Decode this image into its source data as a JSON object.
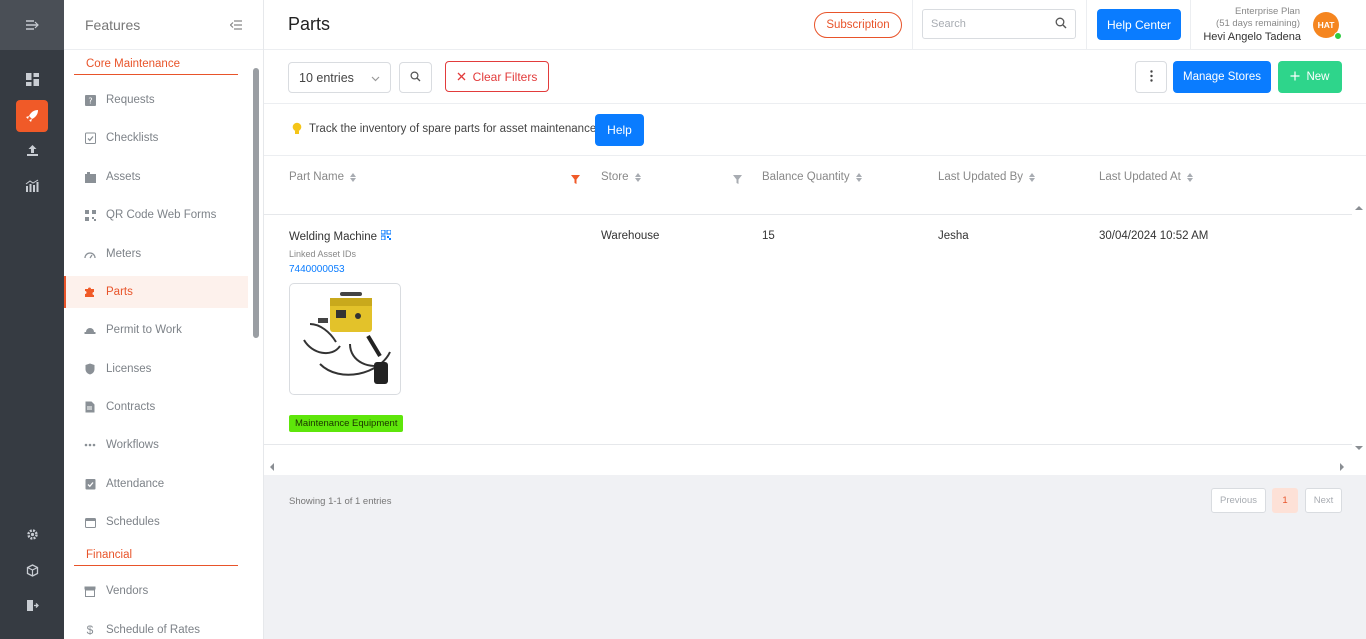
{
  "sidebar": {
    "title": "Features",
    "sections": {
      "core": "Core Maintenance",
      "financial": "Financial"
    },
    "items": [
      {
        "label": "Requests",
        "icon": "question-box-icon"
      },
      {
        "label": "Checklists",
        "icon": "checklist-icon"
      },
      {
        "label": "Assets",
        "icon": "assets-icon"
      },
      {
        "label": "QR Code Web Forms",
        "icon": "qr-code-icon"
      },
      {
        "label": "Meters",
        "icon": "meter-icon"
      },
      {
        "label": "Parts",
        "icon": "puzzle-icon"
      },
      {
        "label": "Permit to Work",
        "icon": "hard-hat-icon"
      },
      {
        "label": "Licenses",
        "icon": "shield-icon"
      },
      {
        "label": "Contracts",
        "icon": "contract-icon"
      },
      {
        "label": "Workflows",
        "icon": "dots-icon"
      },
      {
        "label": "Attendance",
        "icon": "attendance-icon"
      },
      {
        "label": "Schedules",
        "icon": "calendar-icon"
      },
      {
        "label": "Vendors",
        "icon": "vendor-icon"
      },
      {
        "label": "Schedule of Rates",
        "icon": "dollar-icon"
      }
    ]
  },
  "header": {
    "title": "Parts",
    "subscription": "Subscription",
    "search_placeholder": "Search",
    "help_center": "Help Center",
    "plan_name": "Enterprise Plan",
    "plan_remaining": "(51 days remaining)",
    "user_name": "Hevi Angelo Tadena",
    "avatar_initials": "HAT"
  },
  "toolbar": {
    "entries": "10 entries",
    "clear_filters": "Clear Filters",
    "manage_stores": "Manage Stores",
    "new": "New"
  },
  "hint": {
    "text": "Track the inventory of spare parts for asset maintenance",
    "help": "Help"
  },
  "table": {
    "columns": [
      "Part Name",
      "Store",
      "Balance Quantity",
      "Last Updated By",
      "Last Updated At"
    ],
    "rows": [
      {
        "part_name": "Welding Machine",
        "linked_label": "Linked Asset IDs",
        "linked_id": "7440000053",
        "store": "Warehouse",
        "balance": "15",
        "updated_by": "Jesha",
        "updated_at": "30/04/2024 10:52 AM",
        "tag": "Maintenance Equipment"
      }
    ]
  },
  "footer": {
    "showing": "Showing 1-1 of 1 entries",
    "previous": "Previous",
    "page": "1",
    "next": "Next"
  },
  "colors": {
    "accent": "#f05a28",
    "primary": "#0a7cff",
    "success": "#2ed58b",
    "tag": "#5ee60a"
  }
}
